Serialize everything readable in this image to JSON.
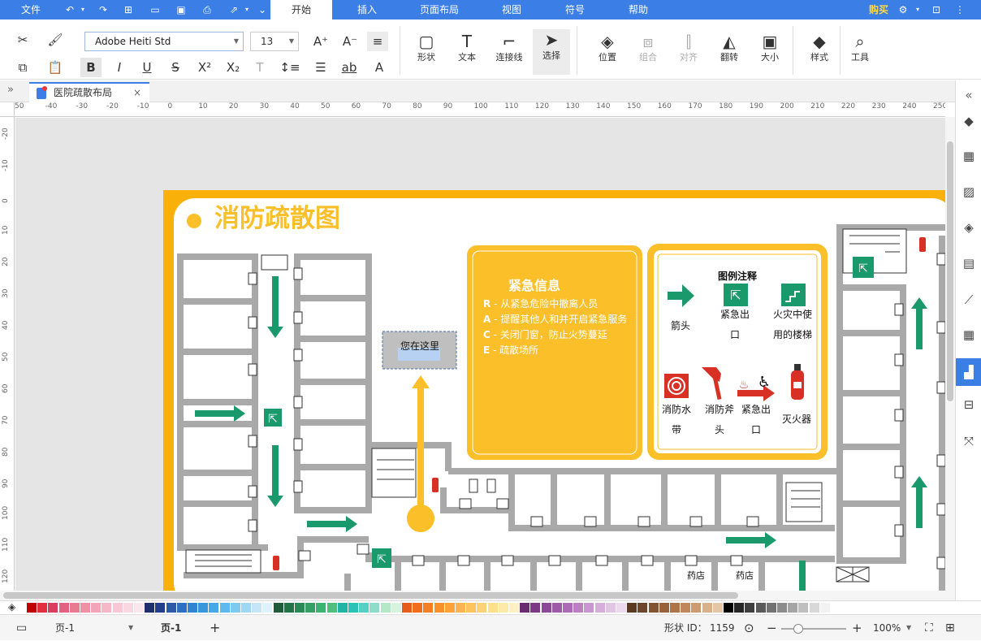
{
  "menu": {
    "file": "文件",
    "tabs": [
      "开始",
      "插入",
      "页面布局",
      "视图",
      "符号",
      "帮助"
    ],
    "buy": "购买"
  },
  "toolbar": {
    "font": "Adobe Heiti Std",
    "size": "13",
    "shape": "形状",
    "text": "文本",
    "connector": "连接线",
    "select": "选择",
    "position": "位置",
    "group": "组合",
    "align": "对齐",
    "flip": "翻转",
    "resize": "大小",
    "style": "样式",
    "tools": "工具"
  },
  "document": {
    "tab_title": "医院疏散布局"
  },
  "ruler": {
    "h": [
      "50",
      "-40",
      "-30",
      "-20",
      "-10",
      "0",
      "10",
      "20",
      "30",
      "40",
      "50",
      "60",
      "70",
      "80",
      "90",
      "100",
      "110",
      "120",
      "130",
      "140",
      "150",
      "160",
      "170",
      "180",
      "190",
      "200",
      "210",
      "220",
      "230",
      "240",
      "250"
    ],
    "v": [
      "-20",
      "-10",
      "0",
      "10",
      "20",
      "30",
      "40",
      "50",
      "60",
      "70",
      "80",
      "90",
      "100",
      "110",
      "120"
    ]
  },
  "map": {
    "title": "消防疏散图",
    "you_are_here": "您在这里",
    "info": {
      "title": "紧急信息",
      "lines": [
        {
          "key": "R",
          "text": " - 从紧急危险中撤离人员"
        },
        {
          "key": "A",
          "text": " - 提醒其他人和并开启紧急服务"
        },
        {
          "key": "C",
          "text": " - 关闭门窗，防止火势蔓延"
        },
        {
          "key": "E",
          "text": " - 疏散场所"
        }
      ]
    },
    "legend": {
      "title": "图例注释",
      "arrow": "箭头",
      "exit_1": "紧急出",
      "exit_2": "口",
      "stair_1": "火灾中使",
      "stair_2": "用的楼梯",
      "hose_1": "消防水",
      "hose_2": "带",
      "axe_1": "消防斧",
      "axe_2": "头",
      "exit2_1": "紧急出",
      "exit2_2": "口",
      "ext": "灭火器"
    },
    "pharmacy": "药店"
  },
  "status": {
    "page_select": "页-1",
    "page_tab": "页-1",
    "shape_id_label": "形状 ID：",
    "shape_id": "1159",
    "zoom": "100%"
  },
  "colors": {
    "accent": "#3a7ee6",
    "orange": "#fbbf2a",
    "map_border": "#f9b10a",
    "green": "#1a9a6c",
    "wall": "#a9a9a9",
    "red": "#d93025"
  },
  "palette": [
    "#c00000",
    "#e03040",
    "#d94060",
    "#e46080",
    "#ea7a90",
    "#f090a6",
    "#f2a4b8",
    "#f6b8c8",
    "#f8c8d6",
    "#fad8e2",
    "#fce6ee",
    "#1f2f6b",
    "#233f8c",
    "#2a5aa8",
    "#2e6fc0",
    "#2f83d0",
    "#3896dc",
    "#47a8e4",
    "#5cbaec",
    "#7ccaf0",
    "#a0d8f4",
    "#c4e6f8",
    "#dff1fb",
    "#1f5c3a",
    "#227347",
    "#2a8a55",
    "#34a063",
    "#3cb371",
    "#4fbf7f",
    "#21b3a3",
    "#2bc2b5",
    "#56cfc4",
    "#8fdcc8",
    "#b5e8c9",
    "#d6f3dd",
    "#e65c1a",
    "#f06d1d",
    "#f57f20",
    "#f8912a",
    "#fba23a",
    "#fdb44c",
    "#fdc45e",
    "#fdd272",
    "#fde08c",
    "#fdeaa8",
    "#fdf1c4",
    "#6a2c70",
    "#7b3a83",
    "#8c4996",
    "#9c5aa7",
    "#ab6cb5",
    "#ba80c2",
    "#c897cf",
    "#d6aedb",
    "#e2c4e5",
    "#eddaef",
    "#5b3a22",
    "#6e4629",
    "#835431",
    "#986339",
    "#ad7447",
    "#bf875a",
    "#cc9b70",
    "#d8b08a",
    "#e4c6a6",
    "#000000",
    "#262626",
    "#3f3f3f",
    "#595959",
    "#727272",
    "#8c8c8c",
    "#a5a5a5",
    "#bfbfbf",
    "#d8d8d8",
    "#f2f2f2"
  ]
}
